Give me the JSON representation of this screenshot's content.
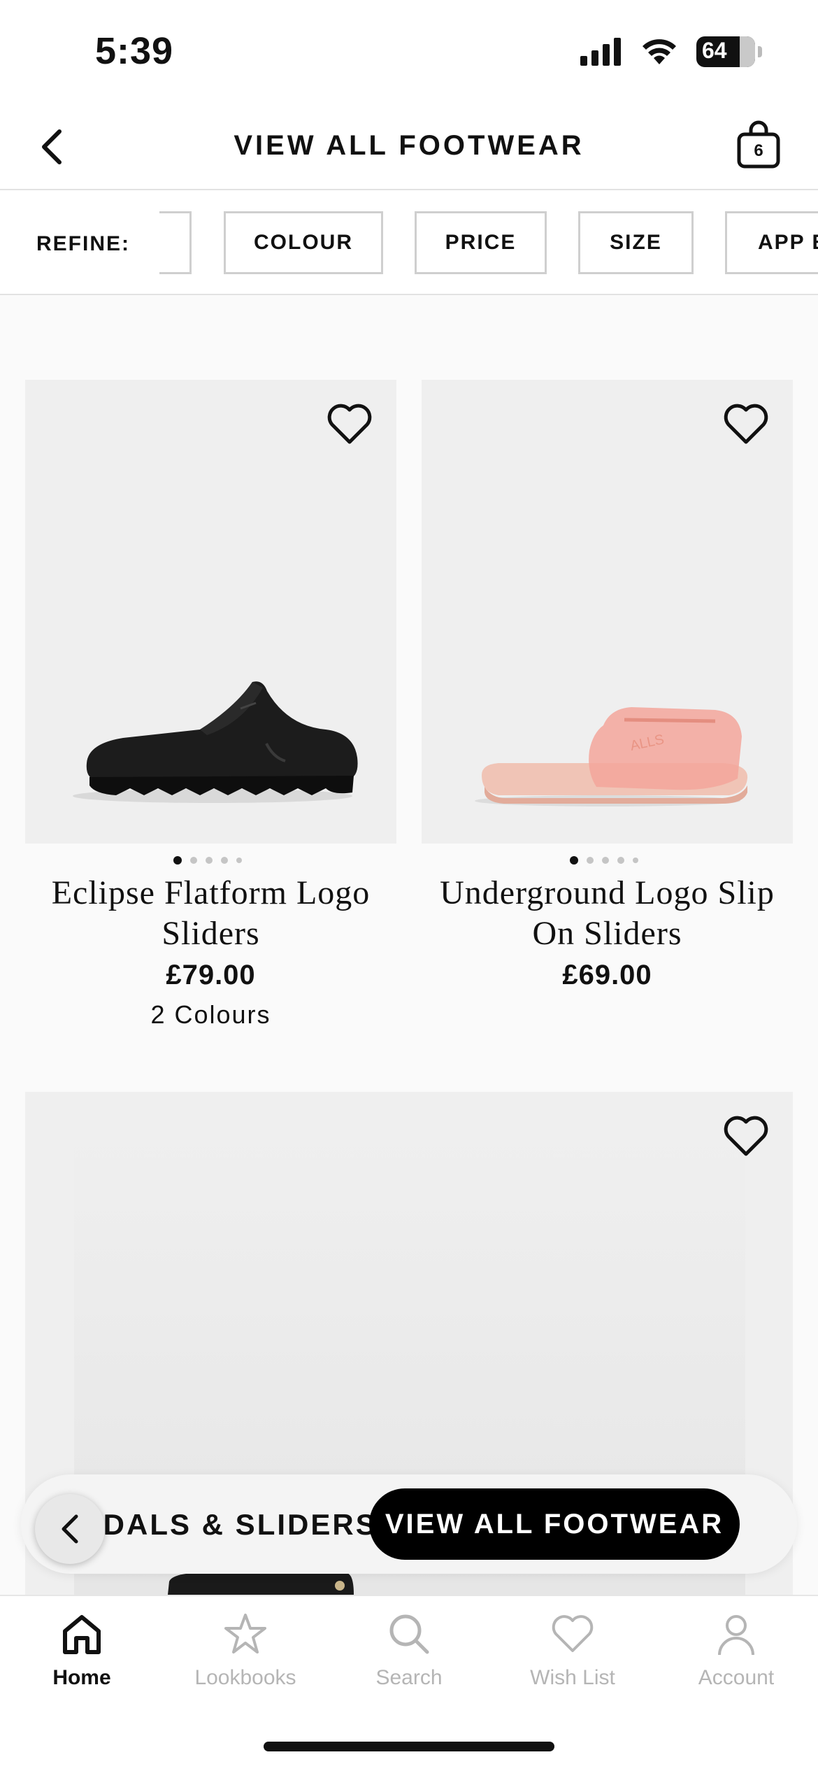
{
  "status_bar": {
    "time": "5:39",
    "battery": "64"
  },
  "header": {
    "title": "VIEW ALL FOOTWEAR",
    "bag_count": "6"
  },
  "filters": {
    "refine_label": "REFINE:",
    "chips": [
      "COLOUR",
      "PRICE",
      "SIZE",
      "APP E"
    ]
  },
  "products": [
    {
      "name": "Eclipse Flatform Logo Sliders",
      "price": "£79.00",
      "colours": "2 Colours",
      "image": "black-slider",
      "carousel_index": 1,
      "carousel_count": 5
    },
    {
      "name": "Underground Logo Slip On Sliders",
      "price": "£69.00",
      "colours": "",
      "image": "pink-slider",
      "carousel_index": 1,
      "carousel_count": 5
    },
    {
      "name": "",
      "price": "",
      "colours": "",
      "image": "black-shoe-partial"
    }
  ],
  "breadcrumb": {
    "previous": "SANDALS & SLIDERS",
    "current": "VIEW ALL FOOTWEAR"
  },
  "tabs": [
    {
      "label": "Home",
      "icon": "home-icon",
      "active": true
    },
    {
      "label": "Lookbooks",
      "icon": "star-icon",
      "active": false
    },
    {
      "label": "Search",
      "icon": "search-icon",
      "active": false
    },
    {
      "label": "Wish List",
      "icon": "heart-icon",
      "active": false
    },
    {
      "label": "Account",
      "icon": "person-icon",
      "active": false
    }
  ],
  "colors": {
    "accent": "#000000",
    "card_bg": "#efefef",
    "inactive_tab": "#b5b5b5"
  }
}
